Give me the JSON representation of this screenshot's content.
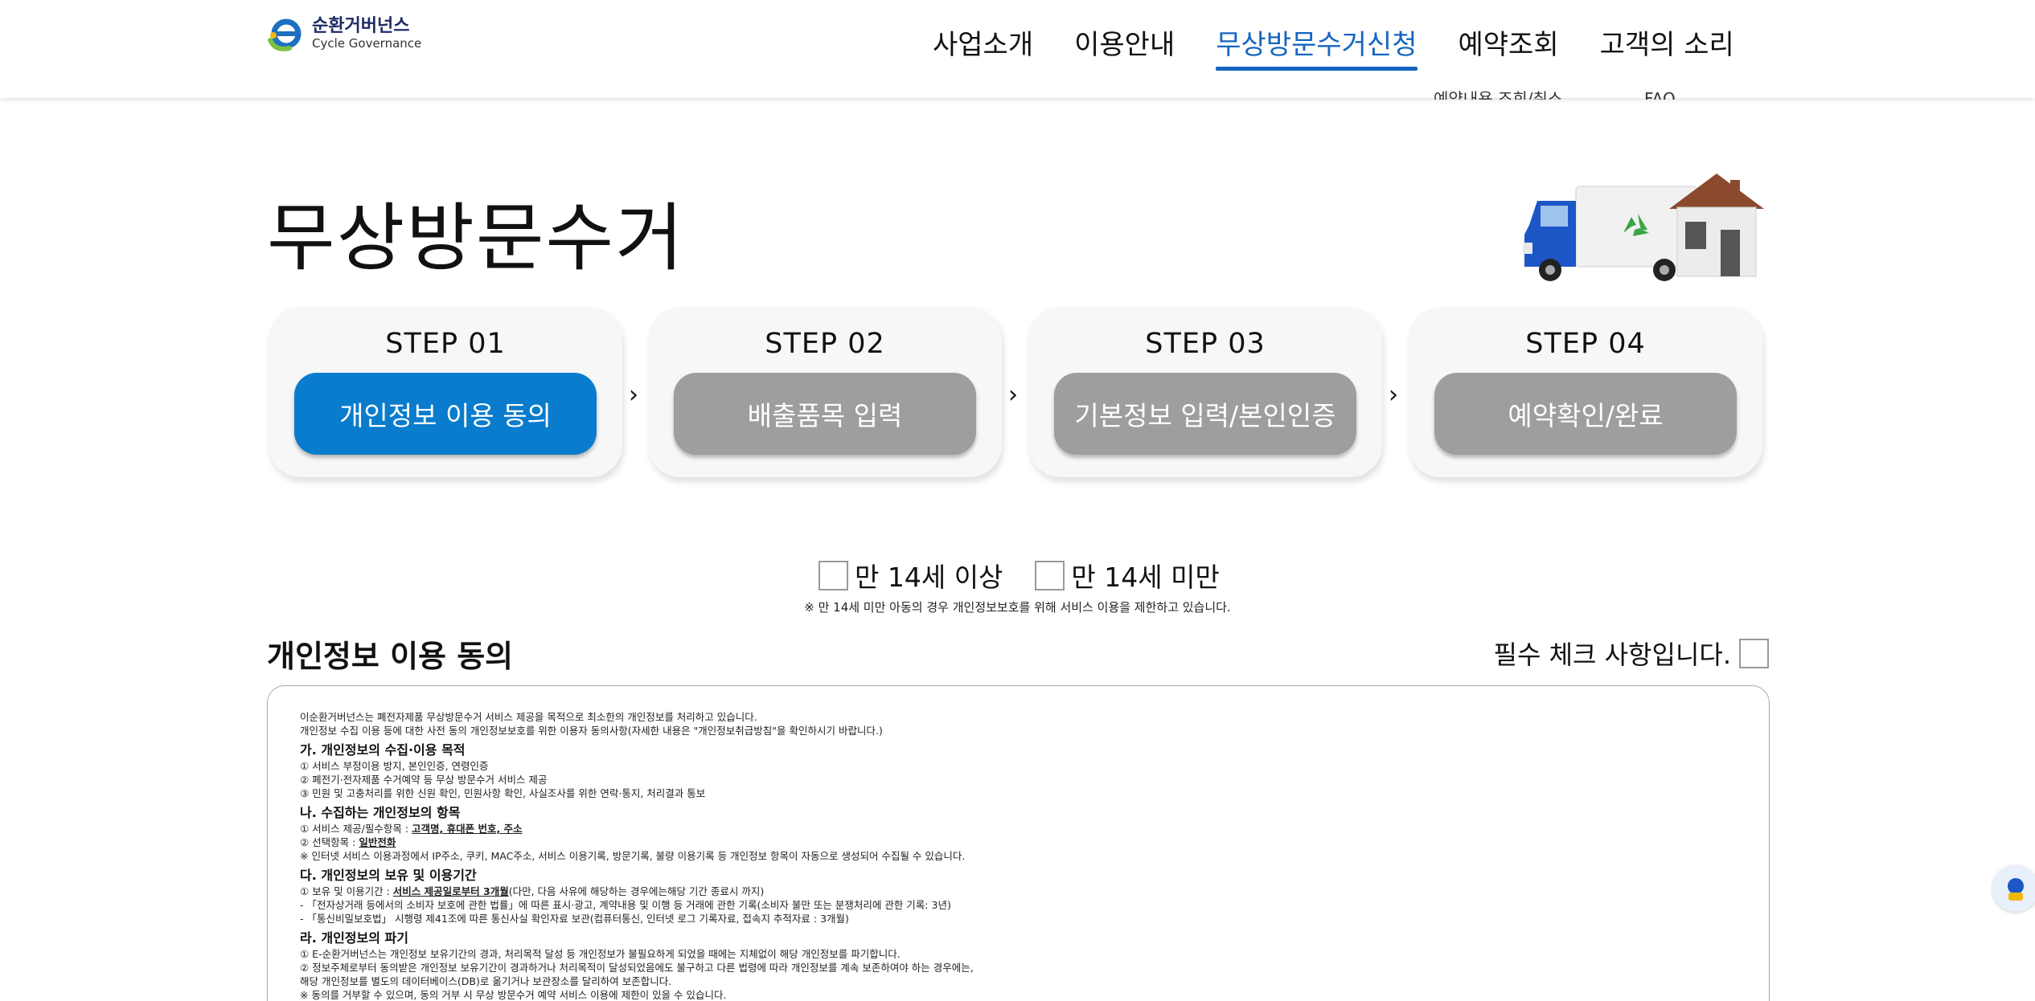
{
  "header": {
    "logo_ko": "순환거버넌스",
    "logo_en": "Cycle Governance",
    "nav": [
      {
        "label": "사업소개"
      },
      {
        "label": "이용안내"
      },
      {
        "label": "무상방문수거신청"
      },
      {
        "label": "예약조회"
      },
      {
        "label": "고객의 소리"
      }
    ],
    "subnav": [
      "예약내용 조회/취소",
      "FAQ"
    ]
  },
  "page": {
    "title": "무상방문수거"
  },
  "steps": [
    {
      "label": "STEP 01",
      "button": "개인정보 이용 동의",
      "active": true
    },
    {
      "label": "STEP 02",
      "button": "배출품목 입력",
      "active": false
    },
    {
      "label": "STEP 03",
      "button": "기본정보 입력/본인인증",
      "active": false
    },
    {
      "label": "STEP 04",
      "button": "예약확인/완료",
      "active": false
    }
  ],
  "step_arrow": "›",
  "age": {
    "over14": "만 14세 이상",
    "under14": "만 14세 미만",
    "note": "※ 만 14세 미만 아동의 경우 개인정보보호를 위해 서비스 이용을 제한하고 있습니다."
  },
  "consent": {
    "title": "개인정보 이용 동의",
    "required_text": "필수 체크 사항입니다.",
    "lines": [
      {
        "type": "line",
        "text": "이순환거버넌스는 폐전자제품 무상방문수거 서비스 제공을 목적으로 최소한의 개인정보를 처리하고 있습니다."
      },
      {
        "type": "line",
        "text": "개인정보 수집 이용 등에 대한 사전 동의 개인정보보호를 위한 이용자 동의사항(자세한 내용은 \"개인정보취급방침\"을 확인하시기 바랍니다.)"
      },
      {
        "type": "head",
        "text": "가. 개인정보의 수집·이용 목적"
      },
      {
        "type": "line",
        "text": "① 서비스 부정이용 방지, 본인인증, 연령인증"
      },
      {
        "type": "line",
        "text": "② 폐전기·전자제품 수거예약 등 무상 방문수거 서비스 제공"
      },
      {
        "type": "line",
        "text": "③ 민원 및 고충처리를 위한 신원 확인, 민원사항 확인, 사실조사를 위한 연락·통지, 처리결과 통보"
      },
      {
        "type": "head",
        "text": "나. 수집하는 개인정보의 항목"
      },
      {
        "type": "line",
        "text": "① 서비스 제공/필수항목 : ",
        "u": "고객명, 휴대폰 번호, 주소"
      },
      {
        "type": "line",
        "text": "② 선택항목 : ",
        "u": "일반전화"
      },
      {
        "type": "line",
        "text": "※ 인터넷 서비스 이용과정에서 IP주소, 쿠키, MAC주소, 서비스 이용기록, 방문기록, 불량 이용기록 등 개인정보 항목이 자동으로 생성되어 수집될 수 있습니다."
      },
      {
        "type": "head",
        "text": "다. 개인정보의 보유 및 이용기간"
      },
      {
        "type": "line",
        "text": "① 보유 및 이용기간 : ",
        "u": "서비스 제공일로부터 3개월",
        "after": "(다만, 다음 사유에 해당하는 경우에는해당 기간 종료시 까지)"
      },
      {
        "type": "line",
        "text": "- 「전자상거래 등에서의 소비자 보호에 관한 법률」에 따른 표시·광고, 계약내용 및 이행 등 거래에 관한 기록(소비자 불만 또는 분쟁처리에 관한 기록: 3년)"
      },
      {
        "type": "line",
        "text": "- 「통신비밀보호법」 시행령 제41조에 따른 통신사실 확인자료 보관(컴퓨터통신, 인터넷 로그 기록자료, 접속지 추적자료 : 3개월)"
      },
      {
        "type": "head",
        "text": "라. 개인정보의 파기"
      },
      {
        "type": "line",
        "text": "① E-순환거버넌스는 개인정보 보유기간의 경과, 처리목적 달성 등 개인정보가 불필요하게 되었을 때에는 지체없이 해당 개인정보를 파기합니다."
      },
      {
        "type": "line",
        "text": "② 정보주체로부터 동의받은 개인정보 보유기간이 경과하거나 처리목적이 달성되었음에도 불구하고 다른 법령에 따라 개인정보를 계속 보존하여야 하는 경우에는,"
      },
      {
        "type": "line",
        "text": "해당 개인정보를 별도의 데이터베이스(DB)로 옮기거나 보관장소를 달리하여 보존합니다."
      },
      {
        "type": "line",
        "text": "※ 동의를 거부할 수 있으며, 동의 거부 시 무상 방문수거 예약 서비스 이용에 제한이 있을 수 있습니다."
      }
    ]
  },
  "colors": {
    "accent": "#0a7ccd",
    "nav_active": "#1565c0",
    "step_inactive": "#9e9e9e"
  }
}
